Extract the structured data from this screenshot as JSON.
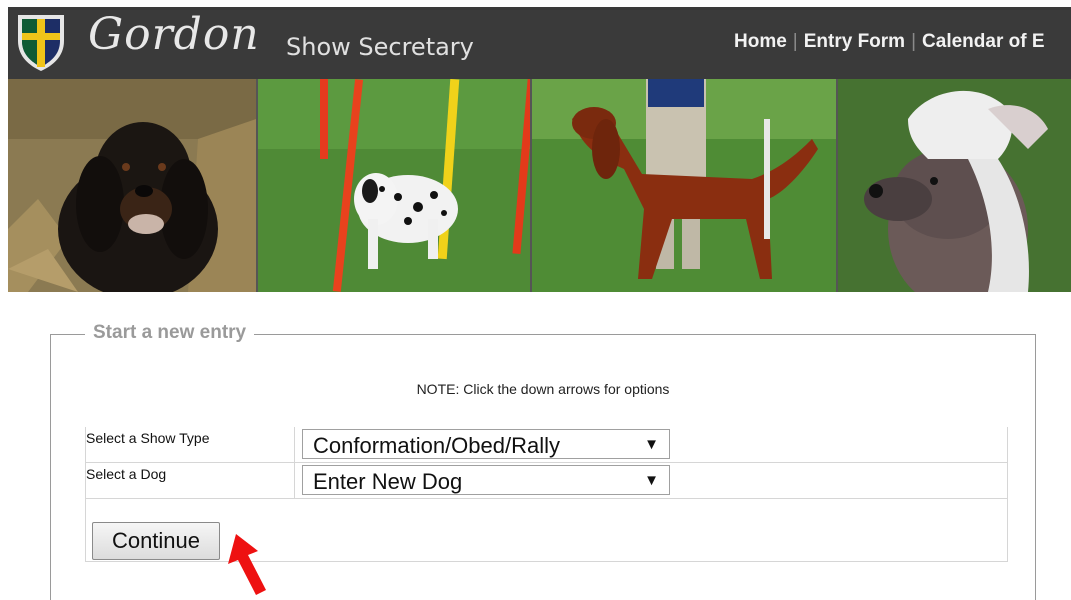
{
  "header": {
    "logo_script": "Gordon",
    "logo_subtitle": "Show Secretary",
    "nav": [
      "Home",
      "Entry Form",
      "Calendar of E"
    ]
  },
  "banner": {
    "photos": [
      "gordon-setter-photo",
      "dalmatian-agility-photo",
      "irish-setter-photo",
      "chinese-crested-photo"
    ]
  },
  "form": {
    "legend": "Start a new entry",
    "note": "NOTE: Click the down arrows for options",
    "show_type_label": "Select a Show Type",
    "show_type_value": "Conformation/Obed/Rally",
    "dog_label": "Select a Dog",
    "dog_value": "Enter New Dog",
    "continue_label": "Continue"
  },
  "annotation": {
    "arrow_color": "#ee1111"
  }
}
